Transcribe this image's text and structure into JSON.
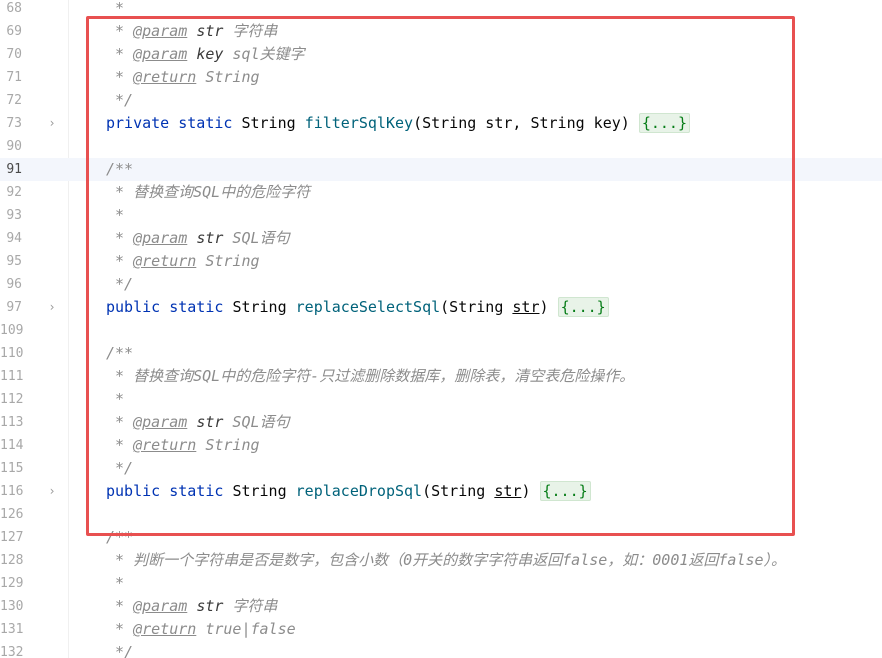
{
  "editor": {
    "current_line": "91",
    "lines": [
      {
        "no": "68",
        "fold": "",
        "parts": [
          {
            "c": "cm",
            "t": " *"
          }
        ]
      },
      {
        "no": "69",
        "fold": "",
        "parts": [
          {
            "c": "cm",
            "t": " * "
          },
          {
            "c": "tag",
            "t": "@param"
          },
          {
            "c": "cm",
            "t": " "
          },
          {
            "c": "tagv",
            "t": "str"
          },
          {
            "c": "cm",
            "t": " 字符串"
          }
        ]
      },
      {
        "no": "70",
        "fold": "",
        "parts": [
          {
            "c": "cm",
            "t": " * "
          },
          {
            "c": "tag",
            "t": "@param"
          },
          {
            "c": "cm",
            "t": " "
          },
          {
            "c": "tagv",
            "t": "key"
          },
          {
            "c": "cm",
            "t": " sql关键字"
          }
        ]
      },
      {
        "no": "71",
        "fold": "",
        "parts": [
          {
            "c": "cm",
            "t": " * "
          },
          {
            "c": "tag",
            "t": "@return"
          },
          {
            "c": "cm",
            "t": " "
          },
          {
            "c": "tagr",
            "t": "String"
          }
        ]
      },
      {
        "no": "72",
        "fold": "",
        "parts": [
          {
            "c": "cm",
            "t": " */"
          }
        ]
      },
      {
        "no": "73",
        "fold": "›",
        "parts": [
          {
            "c": "kw",
            "t": "private static "
          },
          {
            "c": "plain",
            "t": "String "
          },
          {
            "c": "fn",
            "t": "filterSqlKey"
          },
          {
            "c": "plain",
            "t": "(String str, String key) "
          },
          {
            "c": "folded",
            "t": "{...}"
          }
        ]
      },
      {
        "no": "90",
        "fold": "",
        "parts": []
      },
      {
        "no": "91",
        "fold": "",
        "parts": [
          {
            "c": "cm",
            "t": "/**"
          }
        ]
      },
      {
        "no": "92",
        "fold": "",
        "parts": [
          {
            "c": "cm",
            "t": " * 替换查询SQL中的危险字符"
          }
        ]
      },
      {
        "no": "93",
        "fold": "",
        "parts": [
          {
            "c": "cm",
            "t": " *"
          }
        ]
      },
      {
        "no": "94",
        "fold": "",
        "parts": [
          {
            "c": "cm",
            "t": " * "
          },
          {
            "c": "tag",
            "t": "@param"
          },
          {
            "c": "cm",
            "t": " "
          },
          {
            "c": "tagv",
            "t": "str"
          },
          {
            "c": "cm",
            "t": " SQL语句"
          }
        ]
      },
      {
        "no": "95",
        "fold": "",
        "parts": [
          {
            "c": "cm",
            "t": " * "
          },
          {
            "c": "tag",
            "t": "@return"
          },
          {
            "c": "cm",
            "t": " "
          },
          {
            "c": "tagr",
            "t": "String"
          }
        ]
      },
      {
        "no": "96",
        "fold": "",
        "parts": [
          {
            "c": "cm",
            "t": " */"
          }
        ]
      },
      {
        "no": "97",
        "fold": "›",
        "parts": [
          {
            "c": "kw",
            "t": "public static "
          },
          {
            "c": "plain",
            "t": "String "
          },
          {
            "c": "fn",
            "t": "replaceSelectSql"
          },
          {
            "c": "plain",
            "t": "(String "
          },
          {
            "c": "plain ul",
            "t": "str"
          },
          {
            "c": "plain",
            "t": ") "
          },
          {
            "c": "folded",
            "t": "{...}"
          }
        ]
      },
      {
        "no": "109",
        "fold": "",
        "parts": []
      },
      {
        "no": "110",
        "fold": "",
        "parts": [
          {
            "c": "cm",
            "t": "/**"
          }
        ]
      },
      {
        "no": "111",
        "fold": "",
        "parts": [
          {
            "c": "cm",
            "t": " * 替换查询SQL中的危险字符-只过滤删除数据库，删除表，清空表危险操作。"
          }
        ]
      },
      {
        "no": "112",
        "fold": "",
        "parts": [
          {
            "c": "cm",
            "t": " *"
          }
        ]
      },
      {
        "no": "113",
        "fold": "",
        "parts": [
          {
            "c": "cm",
            "t": " * "
          },
          {
            "c": "tag",
            "t": "@param"
          },
          {
            "c": "cm",
            "t": " "
          },
          {
            "c": "tagv",
            "t": "str"
          },
          {
            "c": "cm",
            "t": " SQL语句"
          }
        ]
      },
      {
        "no": "114",
        "fold": "",
        "parts": [
          {
            "c": "cm",
            "t": " * "
          },
          {
            "c": "tag",
            "t": "@return"
          },
          {
            "c": "cm",
            "t": " "
          },
          {
            "c": "tagr",
            "t": "String"
          }
        ]
      },
      {
        "no": "115",
        "fold": "",
        "parts": [
          {
            "c": "cm",
            "t": " */"
          }
        ]
      },
      {
        "no": "116",
        "fold": "›",
        "parts": [
          {
            "c": "kw",
            "t": "public static "
          },
          {
            "c": "plain",
            "t": "String "
          },
          {
            "c": "fn",
            "t": "replaceDropSql"
          },
          {
            "c": "plain",
            "t": "(String "
          },
          {
            "c": "plain ul",
            "t": "str"
          },
          {
            "c": "plain",
            "t": ") "
          },
          {
            "c": "folded",
            "t": "{...}"
          }
        ]
      },
      {
        "no": "126",
        "fold": "",
        "parts": []
      },
      {
        "no": "127",
        "fold": "",
        "parts": [
          {
            "c": "cm",
            "t": "/**"
          }
        ]
      },
      {
        "no": "128",
        "fold": "",
        "parts": [
          {
            "c": "cm",
            "t": " * 判断一个字符串是否是数字，包含小数（0开关的数字字符串返回false，如：0001返回false）。"
          }
        ]
      },
      {
        "no": "129",
        "fold": "",
        "parts": [
          {
            "c": "cm",
            "t": " *"
          }
        ]
      },
      {
        "no": "130",
        "fold": "",
        "parts": [
          {
            "c": "cm",
            "t": " * "
          },
          {
            "c": "tag",
            "t": "@param"
          },
          {
            "c": "cm",
            "t": " "
          },
          {
            "c": "tagv",
            "t": "str"
          },
          {
            "c": "cm",
            "t": " 字符串"
          }
        ]
      },
      {
        "no": "131",
        "fold": "",
        "parts": [
          {
            "c": "cm",
            "t": " * "
          },
          {
            "c": "tag",
            "t": "@return"
          },
          {
            "c": "cm",
            "t": " "
          },
          {
            "c": "tagr",
            "t": "true|false"
          }
        ]
      },
      {
        "no": "132",
        "fold": "",
        "parts": [
          {
            "c": "cm",
            "t": " */"
          }
        ]
      }
    ]
  },
  "annotation": {
    "box_color": "#e85050"
  }
}
